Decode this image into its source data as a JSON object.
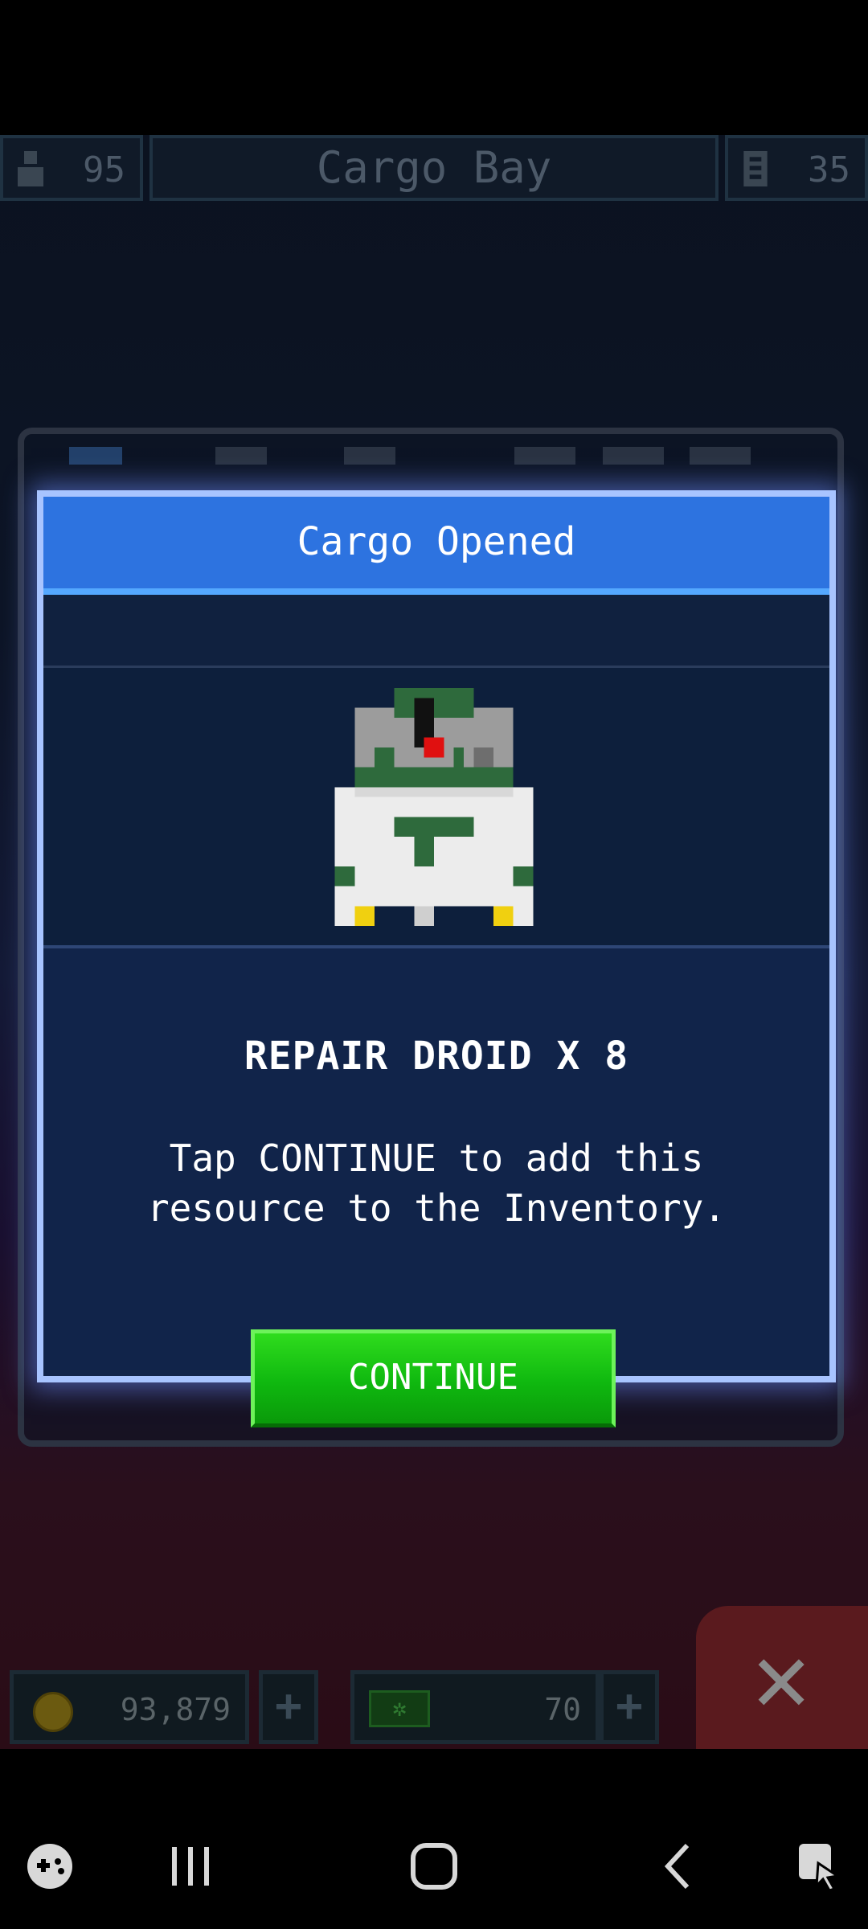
{
  "topbar": {
    "crew_count": "95",
    "screen_title": "Cargo Bay",
    "door_count": "35",
    "crew_icon": "crew-icon",
    "door_icon": "door-icon"
  },
  "dialog": {
    "title": "Cargo Opened",
    "resource_name": "REPAIR DROID X 8",
    "instruction": "Tap CONTINUE to add this resource to the Inventory.",
    "continue_label": "CONTINUE",
    "resource_icon": "repair-droid-icon"
  },
  "bottom_bar": {
    "coins": "93,879",
    "energy": "70",
    "coin_icon": "coin-icon",
    "energy_icon": "energy-icon",
    "plus_label": "+",
    "close_label": "✕"
  },
  "navbar": {
    "icons": [
      "game-launcher-icon",
      "recent-apps-icon",
      "home-icon",
      "back-icon",
      "screenshot-icon"
    ]
  },
  "colors": {
    "header_blue": "#2d73e0",
    "dialog_border": "#a8c4ff",
    "continue_green": "#0fb80f"
  }
}
